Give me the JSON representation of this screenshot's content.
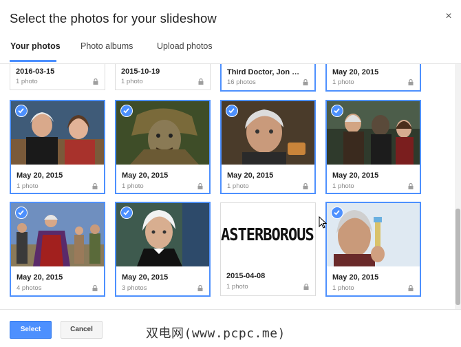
{
  "dialog": {
    "title": "Select the photos for your slideshow",
    "close_icon": "×"
  },
  "tabs": [
    {
      "label": "Your photos",
      "active": true
    },
    {
      "label": "Photo albums",
      "active": false
    },
    {
      "label": "Upload photos",
      "active": false
    }
  ],
  "tiles": [
    {
      "date": "2016-03-15",
      "count": "1 photo",
      "selected": false,
      "thumbnail": "none"
    },
    {
      "date": "2015-10-19",
      "count": "1 photo",
      "selected": false,
      "thumbnail": "none"
    },
    {
      "date": "Third Doctor, Jon Per...",
      "count": "16 photos",
      "selected": true,
      "thumbnail": "none"
    },
    {
      "date": "May 20, 2015",
      "count": "1 photo",
      "selected": true,
      "thumbnail": "none"
    },
    {
      "date": "May 20, 2015",
      "count": "1 photo",
      "selected": true,
      "thumbnail": "photo-two-people"
    },
    {
      "date": "May 20, 2015",
      "count": "1 photo",
      "selected": true,
      "thumbnail": "photo-scarecrow"
    },
    {
      "date": "May 20, 2015",
      "count": "1 photo",
      "selected": true,
      "thumbnail": "photo-man-portrait"
    },
    {
      "date": "May 20, 2015",
      "count": "1 photo",
      "selected": true,
      "thumbnail": "photo-action-scene"
    },
    {
      "date": "May 20, 2015",
      "count": "4 photos",
      "selected": true,
      "thumbnail": "photo-group-cast"
    },
    {
      "date": "May 20, 2015",
      "count": "3 photos",
      "selected": true,
      "thumbnail": "photo-white-hair-man"
    },
    {
      "date": "2015-04-08",
      "count": "1 photo",
      "selected": false,
      "thumbnail": "text-banner",
      "banner_text": "ASTERBOROUS T"
    },
    {
      "date": "May 20, 2015",
      "count": "1 photo",
      "selected": true,
      "thumbnail": "photo-sonic-screwdriver"
    }
  ],
  "buttons": {
    "select_label": "Select",
    "cancel_label": "Cancel"
  },
  "watermark": "双电网(www.pcpc.me)",
  "colors": {
    "accent": "#4d90fe",
    "selected_border": "#4d90fe"
  }
}
